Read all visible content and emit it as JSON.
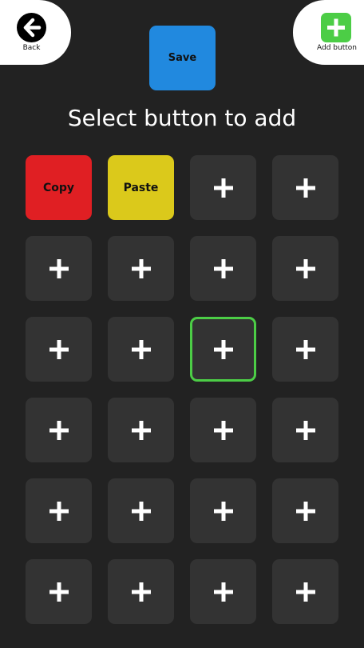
{
  "header": {
    "back_label": "Back",
    "add_label": "Add button",
    "save_label": "Save"
  },
  "title": "Select button to add",
  "colors": {
    "background": "#222222",
    "slot": "#333333",
    "save": "#2189df",
    "copy": "#e01f23",
    "paste": "#dbc91b",
    "accent_green": "#4ccd46"
  },
  "grid": {
    "rows": 6,
    "cols": 4,
    "slots": [
      {
        "label": "Copy",
        "color": "red"
      },
      {
        "label": "Paste",
        "color": "yellow"
      },
      {
        "icon": "plus-icon"
      },
      {
        "icon": "plus-icon"
      },
      {
        "icon": "plus-icon"
      },
      {
        "icon": "plus-icon"
      },
      {
        "icon": "plus-icon"
      },
      {
        "icon": "plus-icon"
      },
      {
        "icon": "plus-icon"
      },
      {
        "icon": "plus-icon"
      },
      {
        "icon": "plus-icon",
        "selected": true
      },
      {
        "icon": "plus-icon"
      },
      {
        "icon": "plus-icon"
      },
      {
        "icon": "plus-icon"
      },
      {
        "icon": "plus-icon"
      },
      {
        "icon": "plus-icon"
      },
      {
        "icon": "plus-icon"
      },
      {
        "icon": "plus-icon"
      },
      {
        "icon": "plus-icon"
      },
      {
        "icon": "plus-icon"
      },
      {
        "icon": "plus-icon"
      },
      {
        "icon": "plus-icon"
      },
      {
        "icon": "plus-icon"
      },
      {
        "icon": "plus-icon"
      }
    ]
  }
}
